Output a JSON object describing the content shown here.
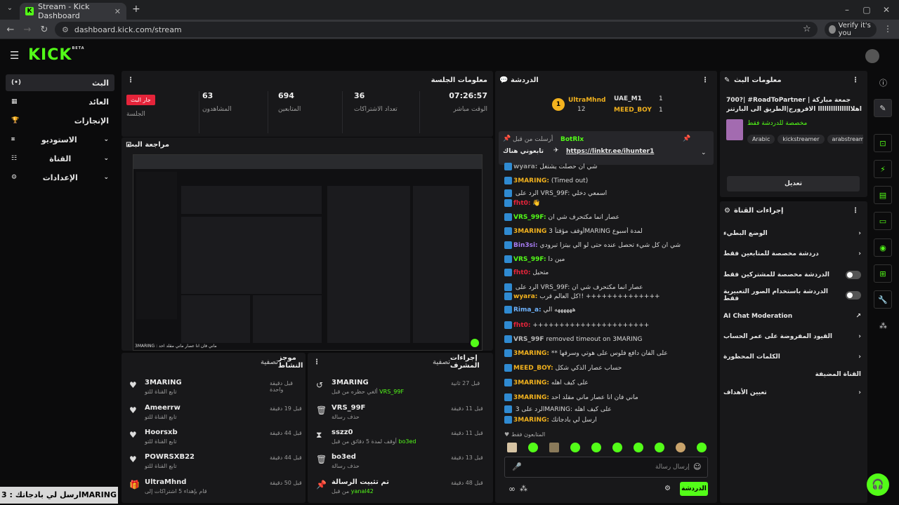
{
  "browser": {
    "tab_title": "Stream - Kick Dashboard",
    "url": "dashboard.kick.com/stream",
    "verify_label": "Verify it's you"
  },
  "brand": {
    "logo": "KICK",
    "beta": "BETA",
    "accent": "#53fc18"
  },
  "sidebar": {
    "items": [
      {
        "label": "البث"
      },
      {
        "label": "العائد"
      },
      {
        "label": "الإنجازات"
      },
      {
        "label": "الاستوديو"
      },
      {
        "label": "القناة"
      },
      {
        "label": "الإعدادات"
      }
    ]
  },
  "session": {
    "title": "معلومات الجلسة",
    "stats": [
      {
        "value": "07:26:57",
        "label": "الوقت مباشر"
      },
      {
        "value": "36",
        "label": "تعداد الاشتراكات"
      },
      {
        "value": "694",
        "label": "المتابعين"
      },
      {
        "value": "63",
        "label": "المشاهدون"
      },
      {
        "value": "جار البث",
        "label": "الجلسة"
      }
    ]
  },
  "preview": {
    "title": "مراجعة البث",
    "caption": "3MARING : ماني فان انا عصار ماني مقلد احد"
  },
  "activity": {
    "title": "موجز النشاط",
    "filter": "تصفية",
    "items": [
      {
        "name": "3MARING",
        "sub": "تابع القناة للتو",
        "time": "قبل دقيقة واحدة"
      },
      {
        "name": "Ameerrw",
        "sub": "تابع القناة للتو",
        "time": "قبل 19 دقيقة"
      },
      {
        "name": "Hoorsxb",
        "sub": "تابع القناة للتو",
        "time": "قبل 44 دقيقة"
      },
      {
        "name": "POWRSXB22",
        "sub": "تابع القناة للتو",
        "time": "قبل 44 دقيقة"
      },
      {
        "name": "UltraMhnd",
        "sub": "قام بإهداء 5 اشتراكات إلى",
        "time": "قبل 50 دقيقة"
      }
    ]
  },
  "modactions": {
    "title": "إجراءات المشرف",
    "filter": "تصفية",
    "items": [
      {
        "name": "3MARING",
        "sub": "ألغي حظره من قبل",
        "by": "VRS_99F",
        "time": "قبل 27 ثانية"
      },
      {
        "name": "VRS_99F",
        "sub": "حذف رسالة",
        "by": "",
        "time": "قبل 11 دقيقة"
      },
      {
        "name": "sszz0",
        "sub": "أوقف لمدة 5 دقائق من قبل",
        "by": "bo3ed",
        "time": "قبل 11 دقيقة"
      },
      {
        "name": "bo3ed",
        "sub": "حذف رسالة",
        "by": "",
        "time": "قبل 13 دقيقة"
      },
      {
        "name": "تم تثبيت الرسالة",
        "sub": "من قبل",
        "by": "yanal42",
        "time": "قبل 48 دقيقة"
      }
    ]
  },
  "chat": {
    "title": "الدردشة",
    "leaders": [
      {
        "name": "UltraMhnd",
        "count": "12"
      },
      {
        "name": "UAE_M1",
        "count": "1"
      },
      {
        "name": "MEED_BOY",
        "count": "1"
      }
    ],
    "pinned": {
      "header": "أرسلت من قبل",
      "user": "BotRlx",
      "text": "https://linktr.ee/ihunter1",
      "label": "تابعوني هناك"
    },
    "lines": [
      {
        "user": "wyara:",
        "text": "شي ان حصلت يشتغل",
        "color": "#9a9a9a"
      },
      {
        "user": "3MARING:",
        "text": "(Timed out)",
        "color": "#f2b21e"
      },
      {
        "user": "",
        "text": "الرد على VRS_99F: اسمعي دخلي",
        "color": "#8a8a8a"
      },
      {
        "user": "fht0:",
        "text": "👋",
        "color": "#e5243a"
      },
      {
        "user": "VRS_99F:",
        "text": "عصار انما مكتحرف شي ان",
        "color": "#53fc18"
      },
      {
        "user": "3MARING",
        "text": "أوقف مؤقتاً 3MARING لمدة أسبوع",
        "color": "#f2b21e"
      },
      {
        "user": "Bin3si:",
        "text": "شي ان كل شيء تحصل عنده حتى لو الي بيتزا تبرودي",
        "color": "#a77cf2"
      },
      {
        "user": "VRS_99F:",
        "text": "مين دا",
        "color": "#53fc18"
      },
      {
        "user": "fht0:",
        "text": "متحيل",
        "color": "#e5243a"
      },
      {
        "user": "",
        "text": "الرد على VRS_99F: عصار انما مكتحرف شي ان",
        "color": "#8a8a8a"
      },
      {
        "user": "wyara:",
        "text": "كل العالم قرب!! ++++++++++++++",
        "color": "#f2b21e"
      },
      {
        "user": "Rima_a:",
        "text": "ههههههه الي",
        "color": "#6fb4ff"
      },
      {
        "user": "fht0:",
        "text": "++++++++++++++++++++++",
        "color": "#e5243a"
      },
      {
        "user": "VRS_99F",
        "text": "removed timeout on 3MARING",
        "color": "#bbb"
      },
      {
        "user": "3MARING:",
        "text": "** على الفان دافع فلوس على هوتي وسرقها",
        "color": "#f2b21e"
      },
      {
        "user": "MEED_BOY:",
        "text": "حساب عصار الذكي شكل",
        "color": "#f2b21e"
      },
      {
        "user": "3MARING:",
        "text": "على كيف اهله",
        "color": "#f2b21e"
      },
      {
        "user": "3MARING:",
        "text": "ماني فان انا عصار ماني مقلد احد",
        "color": "#f2b21e"
      },
      {
        "user": "",
        "text": "الرد على 3MARING: على كيف اهله",
        "color": "#8a8a8a"
      },
      {
        "user": "3MARING:",
        "text": "ارسل لي بادجاتك",
        "color": "#f2b21e"
      }
    ],
    "followers_only": "المتابعون فقط",
    "input_placeholder": "إرسال رسالة",
    "send_label": "الدردشة"
  },
  "streaminfo": {
    "title": "معلومات البث",
    "stream_title": "700?| #RoadToPartner | جمعة مباركة اهلاااااااااااااااا الافرورج|الطريق الى البارتنر",
    "sub": "مخصصة للدردشة فقط",
    "tags": [
      "Arabic",
      "kickstreamer",
      "arabstreame"
    ],
    "edit_label": "تعديل"
  },
  "channelactions": {
    "title": "إجراءات القناة",
    "items": [
      {
        "label": "الوضع البطيء",
        "kind": "arrow"
      },
      {
        "label": "دردشة مخصصة للمتابعين فقط",
        "kind": "arrow"
      },
      {
        "label": "الدردشة مخصصة للمشتركين فقط",
        "kind": "toggle"
      },
      {
        "label": "الدردشة باستخدام الصور التعبيرية فقط",
        "kind": "toggle"
      },
      {
        "label": "AI Chat Moderation",
        "kind": "link"
      },
      {
        "label": "القيود المفروضة على عمر الحساب",
        "kind": "arrow"
      },
      {
        "label": "الكلمات المحظورة",
        "kind": "arrow"
      },
      {
        "label": "القناة المضيفة",
        "kind": "none"
      },
      {
        "label": "تعيين الأهداف",
        "kind": "arrow"
      }
    ]
  },
  "overlay": {
    "text": "ارسل لي بادجاتك : 3MARING"
  }
}
